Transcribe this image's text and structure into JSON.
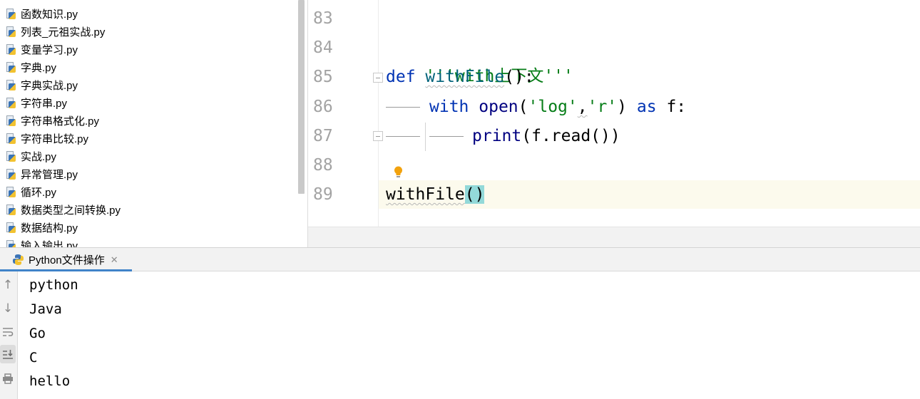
{
  "project_tree": {
    "files": [
      "函数知识.py",
      "列表_元祖实战.py",
      "变量学习.py",
      "字典.py",
      "字典实战.py",
      "字符串.py",
      "字符串格式化.py",
      "字符串比较.py",
      "实战.py",
      "异常管理.py",
      "循环.py",
      "数据类型之间转换.py",
      "数据结构.py",
      "输入输出.py"
    ]
  },
  "editor": {
    "line_numbers": [
      "83",
      "84",
      "85",
      "86",
      "87",
      "88",
      "89"
    ],
    "code": {
      "l84": "'''with上下文'''",
      "l85_kw": "def",
      "l85_fn": "withFile",
      "l85_rest": "():",
      "l86_kw": "with",
      "l86_call": "open",
      "l86_p1": "(",
      "l86_s1": "'log'",
      "l86_comma": ",",
      "l86_s2": "'r'",
      "l86_p2": ")",
      "l86_as": "as",
      "l86_var": "f:",
      "l87_call": "print",
      "l87_rest": "(f.read())",
      "l89_name": "withFile",
      "l89_parens": "()"
    }
  },
  "run_window": {
    "tab_label": "Python文件操作",
    "close_glyph": "✕",
    "toolbar_icons": [
      "arrow-up-icon",
      "arrow-down-icon",
      "soft-wrap-icon",
      "scroll-to-end-icon",
      "print-icon"
    ],
    "output": [
      "python",
      "Java",
      "Go",
      "C",
      "hello"
    ]
  },
  "colors": {
    "keyword": "#0033b3",
    "function": "#00627a",
    "string": "#067d17",
    "current_line": "#fcfaed",
    "brace_highlight": "#93d9d9",
    "accent": "#4083c9"
  }
}
